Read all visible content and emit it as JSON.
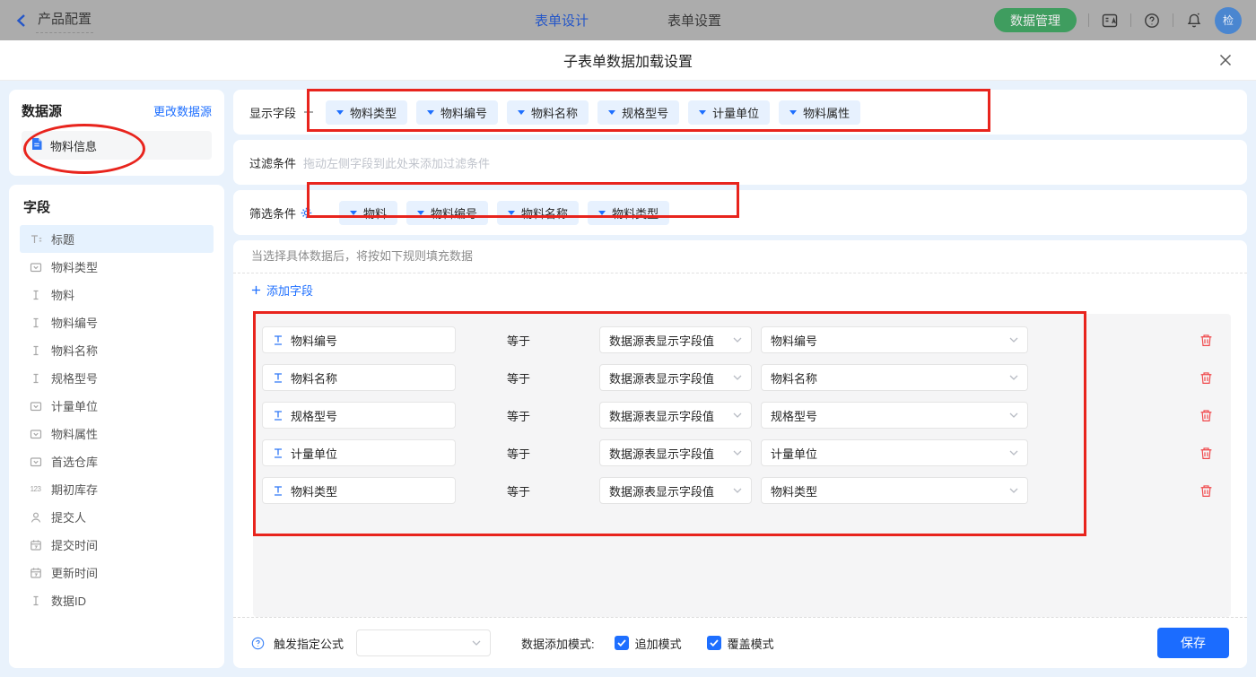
{
  "topbar": {
    "back_label": "产品配置",
    "tabs": [
      {
        "label": "表单设计",
        "active": true
      },
      {
        "label": "表单设置",
        "active": false
      }
    ],
    "data_manage_button": "数据管理",
    "icons": [
      "translate-icon",
      "help-icon",
      "bell-icon"
    ],
    "avatar_text": "检"
  },
  "modal": {
    "title": "子表单数据加载设置"
  },
  "sidebar": {
    "datasource": {
      "title": "数据源",
      "change_link": "更改数据源",
      "item": "物料信息"
    },
    "fields": {
      "title": "字段",
      "items": [
        {
          "label": "标题",
          "icon": "title-field-icon",
          "selected": true
        },
        {
          "label": "物料类型",
          "icon": "select-field-icon",
          "selected": false
        },
        {
          "label": "物料",
          "icon": "text-field-icon",
          "selected": false
        },
        {
          "label": "物料编号",
          "icon": "text-field-icon",
          "selected": false
        },
        {
          "label": "物料名称",
          "icon": "text-field-icon",
          "selected": false
        },
        {
          "label": "规格型号",
          "icon": "text-field-icon",
          "selected": false
        },
        {
          "label": "计量单位",
          "icon": "select-field-icon",
          "selected": false
        },
        {
          "label": "物料属性",
          "icon": "select-field-icon",
          "selected": false
        },
        {
          "label": "首选仓库",
          "icon": "select-field-icon",
          "selected": false
        },
        {
          "label": "期初库存",
          "icon": "number-field-icon",
          "selected": false
        },
        {
          "label": "提交人",
          "icon": "person-icon",
          "selected": false
        },
        {
          "label": "提交时间",
          "icon": "calendar-icon",
          "selected": false
        },
        {
          "label": "更新时间",
          "icon": "calendar-icon",
          "selected": false
        },
        {
          "label": "数据ID",
          "icon": "text-field-icon",
          "selected": false
        }
      ]
    }
  },
  "main": {
    "display_fields": {
      "label": "显示字段",
      "tags": [
        "物料类型",
        "物料编号",
        "物料名称",
        "规格型号",
        "计量单位",
        "物料属性"
      ]
    },
    "filter": {
      "label": "过滤条件",
      "placeholder": "拖动左侧字段到此处来添加过滤条件"
    },
    "screen": {
      "label": "筛选条件",
      "tags": [
        "物料",
        "物料编号",
        "物料名称",
        "物料类型"
      ]
    },
    "rules": {
      "hint": "当选择具体数据后，将按如下规则填充数据",
      "add_field_label": "添加字段",
      "equals_label": "等于",
      "rows": [
        {
          "field": "物料编号",
          "source": "数据源表显示字段值",
          "value": "物料编号"
        },
        {
          "field": "物料名称",
          "source": "数据源表显示字段值",
          "value": "物料名称"
        },
        {
          "field": "规格型号",
          "source": "数据源表显示字段值",
          "value": "规格型号"
        },
        {
          "field": "计量单位",
          "source": "数据源表显示字段值",
          "value": "计量单位"
        },
        {
          "field": "物料类型",
          "source": "数据源表显示字段值",
          "value": "物料类型"
        }
      ]
    },
    "footer": {
      "formula_label": "触发指定公式",
      "formula_value": "",
      "mode_label": "数据添加模式:",
      "checkboxes": [
        {
          "label": "追加模式",
          "checked": true
        },
        {
          "label": "覆盖模式",
          "checked": true
        }
      ],
      "save_label": "保存"
    }
  },
  "colors": {
    "accent_blue": "#1e6fff",
    "tag_background": "#e7f1fe",
    "annotation_red": "#e8241d",
    "danger_red": "#f0474a",
    "topbar_background": "#acacac",
    "topbar_green_button": "#3f9d5f",
    "avatar_blue": "#4a86d0",
    "content_background": "#e9f2fc",
    "panel_gray": "#f5f5f6"
  }
}
